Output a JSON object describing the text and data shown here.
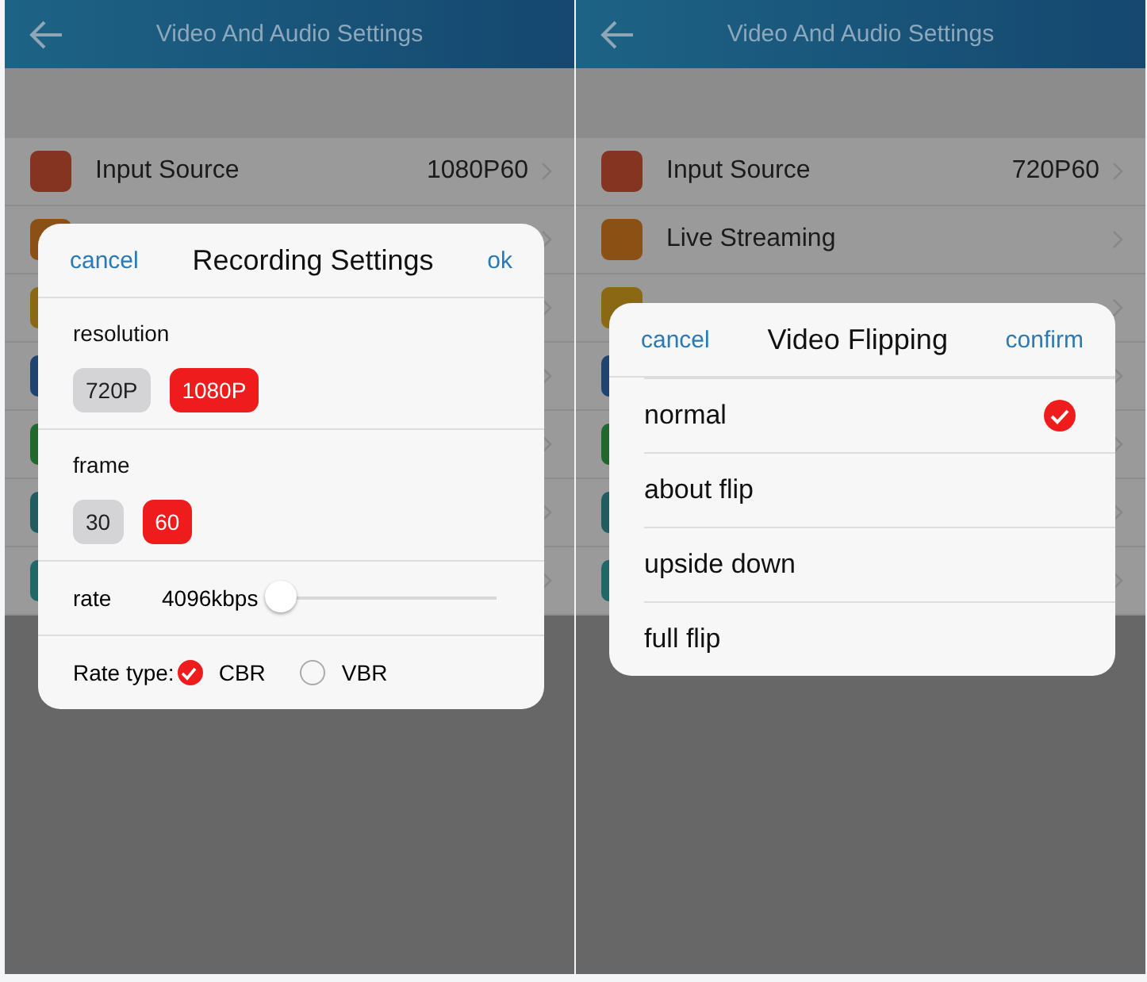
{
  "screens": [
    {
      "header": {
        "title": "Video And Audio Settings"
      },
      "rows": [
        {
          "label": "Input Source",
          "value": "1080P60",
          "color": "#843421"
        },
        {
          "color": "#8a5014"
        },
        {
          "color": "#8a6814"
        },
        {
          "color": "#204472"
        },
        {
          "color": "#20682c"
        },
        {
          "color": "#205c60"
        },
        {
          "color": "#206868"
        }
      ],
      "dialog": {
        "kind": "recording",
        "cancel": "cancel",
        "title": "Recording Settings",
        "confirm": "ok",
        "sections": [
          {
            "label": "resolution",
            "options": [
              {
                "label": "720P",
                "selected": false
              },
              {
                "label": "1080P",
                "selected": true
              }
            ]
          },
          {
            "label": "frame",
            "options": [
              {
                "label": "30",
                "selected": false
              },
              {
                "label": "60",
                "selected": true
              }
            ]
          }
        ],
        "rate": {
          "label": "rate",
          "reading": "4096kbps",
          "level": 0.0
        },
        "rate_type": {
          "label": "Rate type:",
          "options": [
            {
              "label": "CBR",
              "selected": true
            },
            {
              "label": "VBR",
              "selected": false
            }
          ]
        }
      }
    },
    {
      "header": {
        "title": "Video And Audio Settings"
      },
      "rows": [
        {
          "label": "Input Source",
          "value": "720P60",
          "color": "#843421"
        },
        {
          "label": "Live Streaming",
          "color": "#8a5014"
        },
        {
          "color": "#8a6814"
        },
        {
          "color": "#204472"
        },
        {
          "color": "#20682c"
        },
        {
          "color": "#205c60"
        },
        {
          "color": "#206868"
        }
      ],
      "dialog": {
        "kind": "list",
        "cancel": "cancel",
        "title": "Video Flipping",
        "confirm": "confirm",
        "options": [
          {
            "label": "normal",
            "selected": true
          },
          {
            "label": "about flip",
            "selected": false
          },
          {
            "label": "upside down",
            "selected": false
          },
          {
            "label": "full flip",
            "selected": false
          }
        ]
      }
    }
  ]
}
